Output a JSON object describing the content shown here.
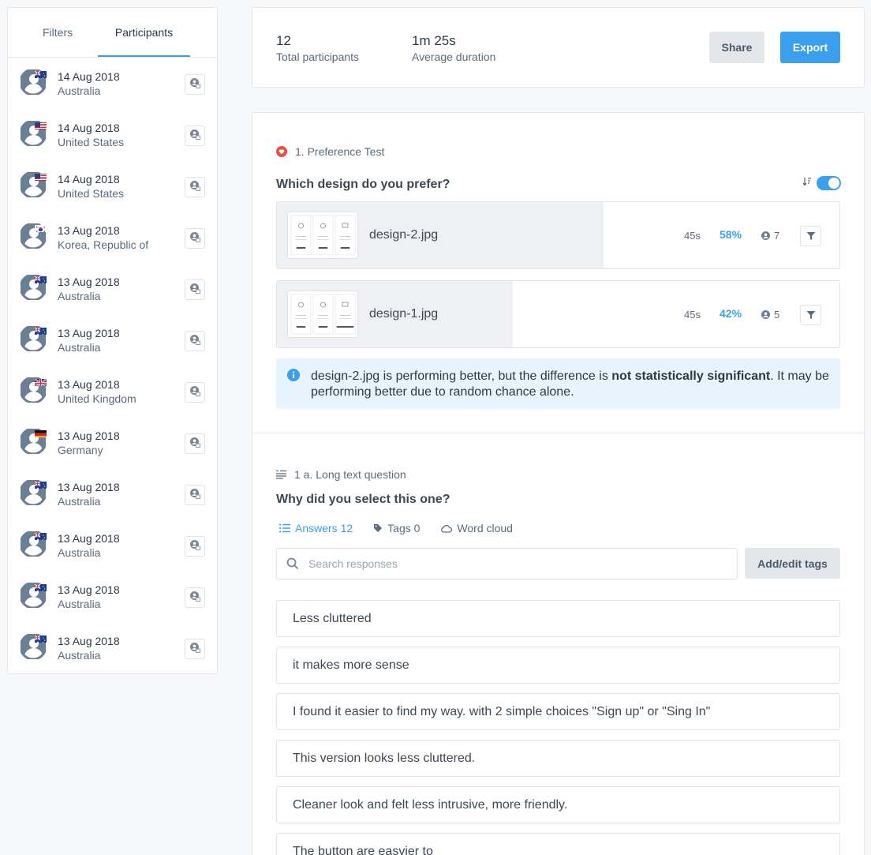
{
  "sidebar": {
    "tabs": {
      "filters": "Filters",
      "participants": "Participants"
    },
    "participants": [
      {
        "date": "14 Aug 2018",
        "country": "Australia",
        "flag": "au"
      },
      {
        "date": "14 Aug 2018",
        "country": "United States",
        "flag": "us"
      },
      {
        "date": "14 Aug 2018",
        "country": "United States",
        "flag": "us"
      },
      {
        "date": "13 Aug 2018",
        "country": "Korea, Republic of",
        "flag": "kr"
      },
      {
        "date": "13 Aug 2018",
        "country": "Australia",
        "flag": "au"
      },
      {
        "date": "13 Aug 2018",
        "country": "Australia",
        "flag": "au"
      },
      {
        "date": "13 Aug 2018",
        "country": "United Kingdom",
        "flag": "gb"
      },
      {
        "date": "13 Aug 2018",
        "country": "Germany",
        "flag": "de"
      },
      {
        "date": "13 Aug 2018",
        "country": "Australia",
        "flag": "au"
      },
      {
        "date": "13 Aug 2018",
        "country": "Australia",
        "flag": "au"
      },
      {
        "date": "13 Aug 2018",
        "country": "Australia",
        "flag": "au"
      },
      {
        "date": "13 Aug 2018",
        "country": "Australia",
        "flag": "au"
      }
    ]
  },
  "stats": {
    "total_value": "12",
    "total_label": "Total participants",
    "duration_value": "1m 25s",
    "duration_label": "Average duration",
    "share_label": "Share",
    "export_label": "Export"
  },
  "preference": {
    "section_label": "1. Preference Test",
    "question": "Which design do you prefer?",
    "designs": [
      {
        "name": "design-2.jpg",
        "time": "45s",
        "percent": "58%",
        "share": 0.58,
        "count": "7"
      },
      {
        "name": "design-1.jpg",
        "time": "45s",
        "percent": "42%",
        "share": 0.42,
        "count": "5"
      }
    ],
    "notice_prefix": "design-2.jpg is performing better, but the difference is ",
    "notice_bold": "not statistically significant",
    "notice_suffix": ". It may be performing better due to random chance alone."
  },
  "long_text": {
    "section_label": "1 a. Long text question",
    "question": "Why did you select this one?",
    "tabs": {
      "answers": "Answers 12",
      "tags": "Tags 0",
      "word_cloud": "Word cloud"
    },
    "search_placeholder": "Search responses",
    "add_tags_label": "Add/edit tags",
    "answers": [
      "Less cluttered",
      "it makes more sense",
      "I found it easier to find my way. with 2 simple choices \"Sign up\" or \"Sing In\"",
      "This version looks less cluttered.",
      "Cleaner look and felt less intrusive, more friendly.",
      "The button are easvier to"
    ]
  },
  "colors": {
    "accent": "#3aa0ee",
    "notice_bg": "#e8f4fd",
    "heart": "#e5534b"
  }
}
